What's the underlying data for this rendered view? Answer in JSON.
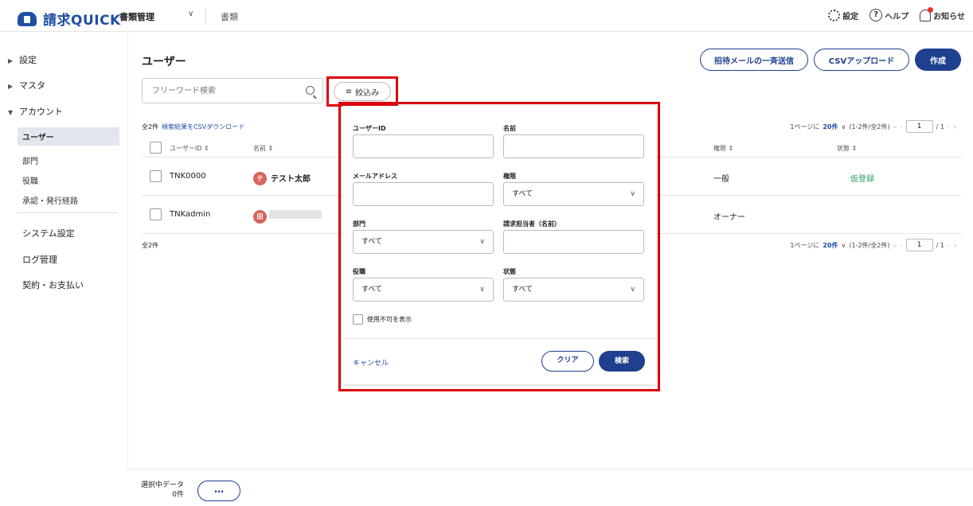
{
  "header": {
    "logo_text": "請求QUICK",
    "app_select": "書類管理",
    "tab": "書類",
    "settings": "設定",
    "help": "ヘルプ",
    "notifications": "お知らせ"
  },
  "sidebar": {
    "groups": [
      "設定",
      "マスタ",
      "アカウント"
    ],
    "account_items": [
      "ユーザー",
      "部門",
      "役職",
      "承認・発行経路"
    ],
    "main_items": [
      "システム設定",
      "ログ管理",
      "契約・お支払い"
    ]
  },
  "page": {
    "title": "ユーザー",
    "invite_button": "招待メールの一斉送信",
    "csv_upload_button": "CSVアップロード",
    "create_button": "作成",
    "search_placeholder": "フリーワード検索",
    "filter_button": "絞込み",
    "total_count": "全2件",
    "csv_download_link": "検索結果をCSVダウンロード"
  },
  "pager": {
    "per_page_label": "1ページに",
    "per_page_value": "20件",
    "range": "(1-2件/全2件)",
    "current": "1",
    "total_pages": "/ 1"
  },
  "table": {
    "columns": [
      "ユーザーID",
      "名前",
      "権限",
      "状態"
    ],
    "rows": [
      {
        "id": "TNK0000",
        "avatar": "テ",
        "name": "テスト太郎",
        "role": "一般",
        "status": "仮登録"
      },
      {
        "id": "TNKadmin",
        "avatar": "田",
        "name": "",
        "role": "オーナー",
        "status": ""
      }
    ]
  },
  "footer": {
    "selected_label": "選択中データ",
    "selected_count": "0件",
    "more_button": "…"
  },
  "filter_panel": {
    "user_id_label": "ユーザーID",
    "name_label": "名前",
    "email_label": "メールアドレス",
    "permission_label": "権限",
    "permission_value": "すべて",
    "department_label": "部門",
    "department_value": "すべて",
    "billing_owner_label": "請求担当者（名前）",
    "position_label": "役職",
    "position_value": "すべて",
    "status_label": "状態",
    "status_value": "すべて",
    "show_disabled_label": "使用不可を表示",
    "cancel": "キャンセル",
    "clear": "クリア",
    "search": "検索"
  }
}
